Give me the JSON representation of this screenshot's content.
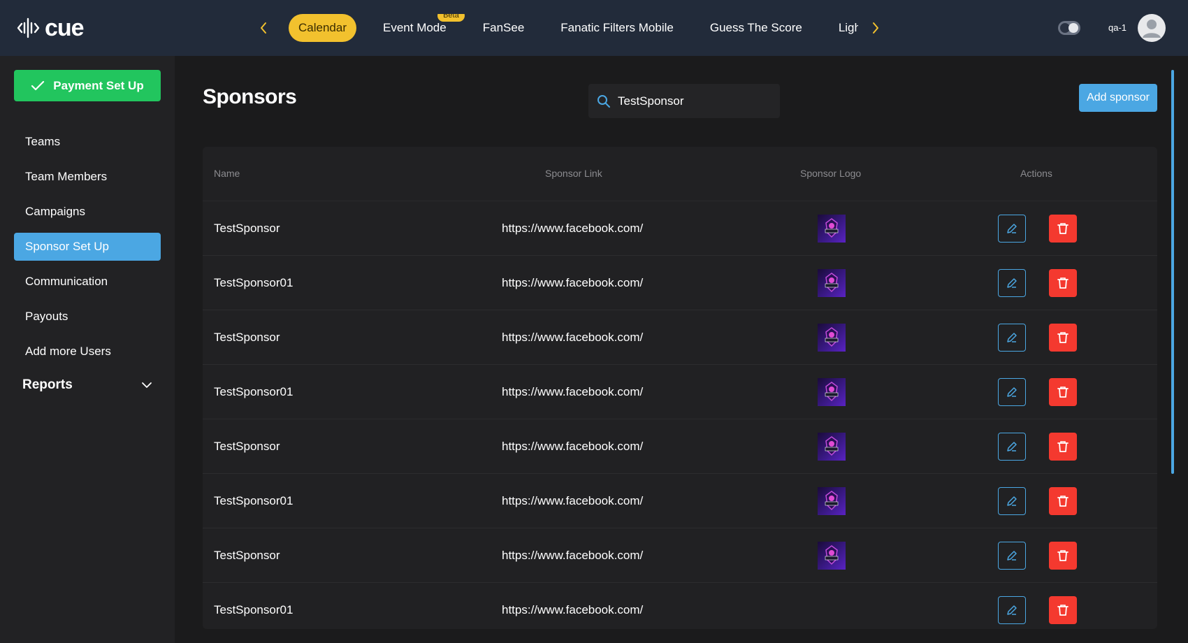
{
  "header": {
    "brand": "cue",
    "tabs": [
      {
        "label": "Calendar",
        "active": true
      },
      {
        "label": "Event Mode",
        "badge": "Beta"
      },
      {
        "label": "FanSee"
      },
      {
        "label": "Fanatic Filters Mobile"
      },
      {
        "label": "Guess The Score"
      },
      {
        "label": "Light"
      }
    ],
    "username": "qa-1"
  },
  "sidebar": {
    "payment_button": "Payment Set Up",
    "items": [
      {
        "label": "Teams"
      },
      {
        "label": "Team Members"
      },
      {
        "label": "Campaigns"
      },
      {
        "label": "Sponsor Set Up",
        "active": true
      },
      {
        "label": "Communication"
      },
      {
        "label": "Payouts"
      },
      {
        "label": "Add more Users"
      }
    ],
    "reports": "Reports"
  },
  "main": {
    "title": "Sponsors",
    "search_value": "TestSponsor",
    "add_button": "Add sponsor",
    "columns": [
      "Name",
      "Sponsor Link",
      "Sponsor Logo",
      "Actions"
    ],
    "rows": [
      {
        "name": "TestSponsor",
        "link": "https://www.facebook.com/",
        "has_logo": true
      },
      {
        "name": "TestSponsor01",
        "link": "https://www.facebook.com/",
        "has_logo": true
      },
      {
        "name": "TestSponsor",
        "link": "https://www.facebook.com/",
        "has_logo": true
      },
      {
        "name": "TestSponsor01",
        "link": "https://www.facebook.com/",
        "has_logo": true
      },
      {
        "name": "TestSponsor",
        "link": "https://www.facebook.com/",
        "has_logo": true
      },
      {
        "name": "TestSponsor01",
        "link": "https://www.facebook.com/",
        "has_logo": true
      },
      {
        "name": "TestSponsor",
        "link": "https://www.facebook.com/",
        "has_logo": true
      },
      {
        "name": "TestSponsor01",
        "link": "https://www.facebook.com/",
        "has_logo": false
      }
    ]
  },
  "colors": {
    "accent_blue": "#4ba7e3",
    "active_tab": "#f2c12e",
    "success_green": "#22c55e",
    "danger_red": "#f4392f"
  },
  "icons": [
    "waveform-logo-icon",
    "chevron-left-icon",
    "chevron-right-icon",
    "theme-toggle-icon",
    "user-avatar-icon",
    "check-icon",
    "chevron-down-icon",
    "search-icon",
    "edit-pencil-icon",
    "trash-icon"
  ]
}
